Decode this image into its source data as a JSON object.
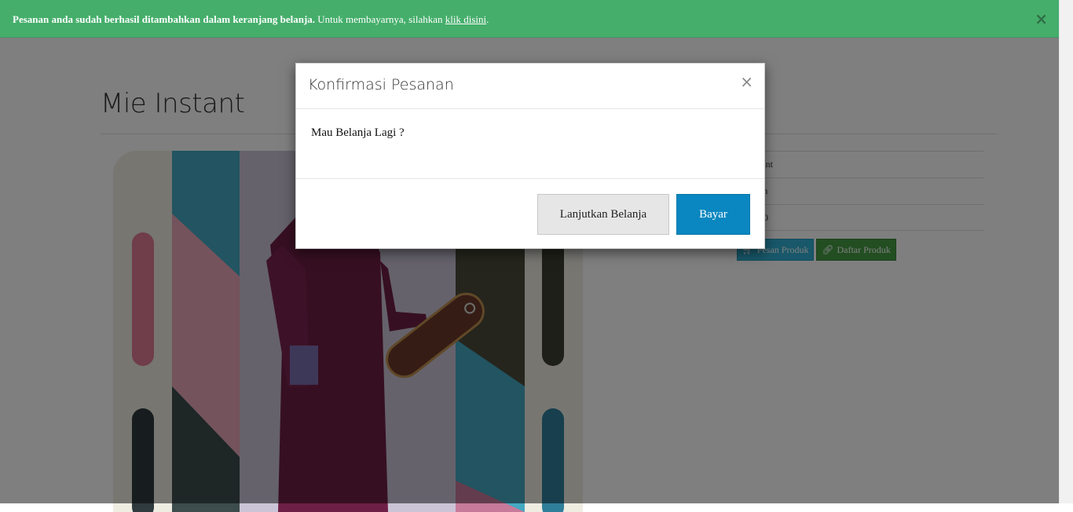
{
  "alert": {
    "message_bold": "Pesanan anda sudah berhasil ditambahkan dalam keranjang belanja.",
    "message_text": " Untuk membayarnya, silahkan ",
    "link_text": "klik disini",
    "message_end": ".",
    "close_label": "×"
  },
  "product": {
    "title": "Mie Instant",
    "rows": [
      {
        "value": "tant"
      },
      {
        "value": "an"
      },
      {
        "value": "00"
      }
    ],
    "order_button": "Pesan Produk",
    "list_button": "Daftar Produk"
  },
  "modal": {
    "title": "Konfirmasi Pesanan",
    "close_label": "×",
    "body": "Mau Belanja Lagi ?",
    "continue_button": "Lanjutkan Belanja",
    "pay_button": "Bayar"
  },
  "colors": {
    "alert_bg": "#45ae6b",
    "pay_button": "#0a87c0",
    "order_button": "#31b0d5",
    "list_button": "#449d44"
  }
}
